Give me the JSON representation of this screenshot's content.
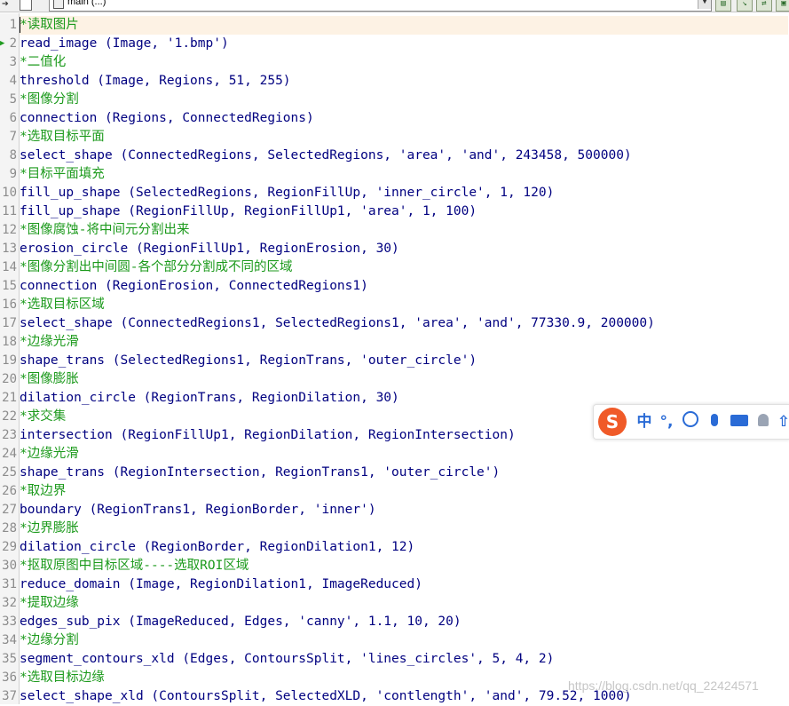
{
  "toolbar": {
    "document_name": "main (...)"
  },
  "editor": {
    "current_line": 2,
    "lines": [
      {
        "no": "1",
        "text": "*读取图片",
        "kind": "comment"
      },
      {
        "no": "2",
        "text": "read_image (Image, '1.bmp')",
        "kind": "code"
      },
      {
        "no": "3",
        "text": "*二值化",
        "kind": "comment"
      },
      {
        "no": "4",
        "text": "threshold (Image, Regions, 51, 255)",
        "kind": "code"
      },
      {
        "no": "5",
        "text": "*图像分割",
        "kind": "comment"
      },
      {
        "no": "6",
        "text": "connection (Regions, ConnectedRegions)",
        "kind": "code"
      },
      {
        "no": "7",
        "text": "*选取目标平面",
        "kind": "comment"
      },
      {
        "no": "8",
        "text": "select_shape (ConnectedRegions, SelectedRegions, 'area', 'and', 243458, 500000)",
        "kind": "code"
      },
      {
        "no": "9",
        "text": "*目标平面填充",
        "kind": "comment"
      },
      {
        "no": "10",
        "text": "fill_up_shape (SelectedRegions, RegionFillUp, 'inner_circle', 1, 120)",
        "kind": "code"
      },
      {
        "no": "11",
        "text": "fill_up_shape (RegionFillUp, RegionFillUp1, 'area', 1, 100)",
        "kind": "code"
      },
      {
        "no": "12",
        "text": "*图像腐蚀-将中间元分割出来",
        "kind": "comment"
      },
      {
        "no": "13",
        "text": "erosion_circle (RegionFillUp1, RegionErosion, 30)",
        "kind": "code"
      },
      {
        "no": "14",
        "text": "*图像分割出中间圆-各个部分分割成不同的区域",
        "kind": "comment"
      },
      {
        "no": "15",
        "text": "connection (RegionErosion, ConnectedRegions1)",
        "kind": "code"
      },
      {
        "no": "16",
        "text": "*选取目标区域",
        "kind": "comment"
      },
      {
        "no": "17",
        "text": "select_shape (ConnectedRegions1, SelectedRegions1, 'area', 'and', 77330.9, 200000)",
        "kind": "code"
      },
      {
        "no": "18",
        "text": "*边缘光滑",
        "kind": "comment"
      },
      {
        "no": "19",
        "text": "shape_trans (SelectedRegions1, RegionTrans, 'outer_circle')",
        "kind": "code"
      },
      {
        "no": "20",
        "text": "*图像膨胀",
        "kind": "comment"
      },
      {
        "no": "21",
        "text": "dilation_circle (RegionTrans, RegionDilation, 30)",
        "kind": "code"
      },
      {
        "no": "22",
        "text": "*求交集",
        "kind": "comment"
      },
      {
        "no": "23",
        "text": "intersection (RegionFillUp1, RegionDilation, RegionIntersection)",
        "kind": "code"
      },
      {
        "no": "24",
        "text": "*边缘光滑",
        "kind": "comment"
      },
      {
        "no": "25",
        "text": "shape_trans (RegionIntersection, RegionTrans1, 'outer_circle')",
        "kind": "code"
      },
      {
        "no": "26",
        "text": "*取边界",
        "kind": "comment"
      },
      {
        "no": "27",
        "text": "boundary (RegionTrans1, RegionBorder, 'inner')",
        "kind": "code"
      },
      {
        "no": "28",
        "text": "*边界膨胀",
        "kind": "comment"
      },
      {
        "no": "29",
        "text": "dilation_circle (RegionBorder, RegionDilation1, 12)",
        "kind": "code"
      },
      {
        "no": "30",
        "text": "*抠取原图中目标区域----选取ROI区域",
        "kind": "comment"
      },
      {
        "no": "31",
        "text": "reduce_domain (Image, RegionDilation1, ImageReduced)",
        "kind": "code"
      },
      {
        "no": "32",
        "text": "*提取边缘",
        "kind": "comment"
      },
      {
        "no": "33",
        "text": "edges_sub_pix (ImageReduced, Edges, 'canny', 1.1, 10, 20)",
        "kind": "code"
      },
      {
        "no": "34",
        "text": "*边缘分割",
        "kind": "comment"
      },
      {
        "no": "35",
        "text": "segment_contours_xld (Edges, ContoursSplit, 'lines_circles', 5, 4, 2)",
        "kind": "code"
      },
      {
        "no": "36",
        "text": "*选取目标边缘",
        "kind": "comment"
      },
      {
        "no": "37",
        "text": "select_shape_xld (ContoursSplit, SelectedXLD, 'contlength', 'and', 79.52, 1000)",
        "kind": "code"
      }
    ]
  },
  "ime": {
    "logo": "S",
    "mode_label": "中",
    "punct_label": "°,",
    "more_label": "⇧",
    "icons": [
      "sogou-logo-icon",
      "emoji-icon",
      "microphone-icon",
      "keyboard-icon",
      "user-icon",
      "arrow-up-icon"
    ]
  },
  "watermark": "https://blog.csdn.net/qq_22424571",
  "colors": {
    "code": "#000080",
    "comment": "#1c9a1c",
    "line_number": "#8c8c8c",
    "current_line_bg": "#fdf2e4",
    "ime_logo": "#f05a28",
    "ime_icons": "#2a6bd6"
  }
}
